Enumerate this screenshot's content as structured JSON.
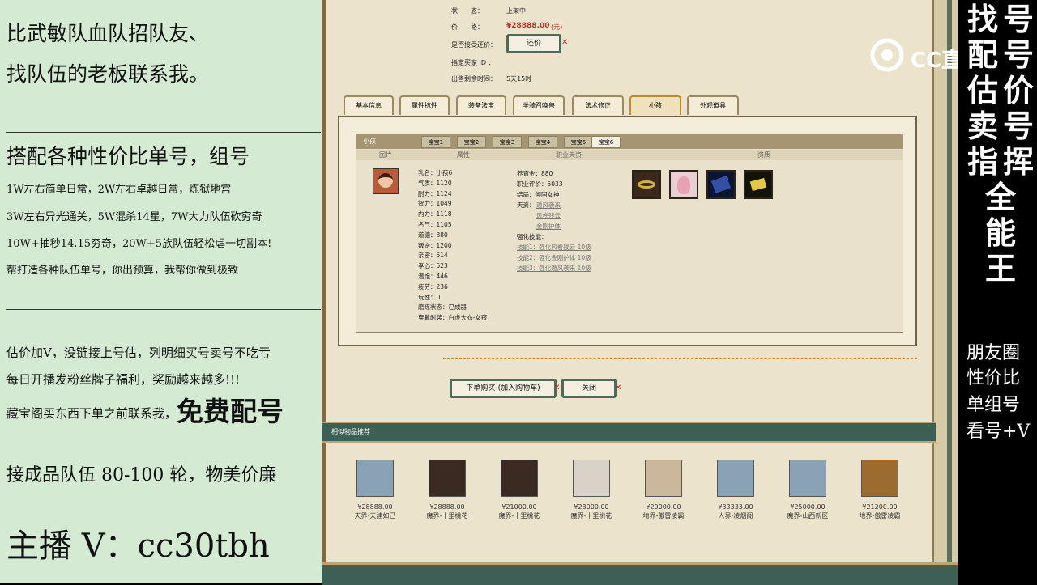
{
  "left_panel": {
    "line1": "比武敏队血队招队友、",
    "line2": "找队伍的老板联系我。",
    "heading2": "搭配各种性价比单号，组号",
    "p1": "1W左右简单日常，2W左右卓越日常，炼狱地宫",
    "p2": "3W左右异光通关，5W混杀14星，7W大力队伍砍穷奇",
    "p3": "10W+抽秒14.15穷奇，20W+5族队伍轻松虐一切副本!",
    "p4": "帮打造各种队伍单号，你出预算，我帮你做到极致",
    "p5": "估价加V，没链接上号估，列明细买号卖号不吃亏",
    "p6": "每日开播发粉丝牌子福利，奖励越来越多!!!",
    "p7_prefix": "藏宝阁买东西下单之前联系我，",
    "p7_big": "免费配号",
    "p8": "接成品队伍 80-100 轮，物美价廉",
    "anchor": "主播 V：cc30tbh"
  },
  "listing": {
    "status_label": "状　　态：",
    "status_value": "上架中",
    "price_label": "价　　格：",
    "price_value": "¥28888.00",
    "price_unit": "(元)",
    "bargain_label": "是否接受还价：",
    "bargain_button": "还价",
    "buyer_label": "指定买家 ID ：",
    "time_label": "出售剩余时间：",
    "time_value": "5天15时"
  },
  "tabs": [
    "基本信息",
    "属性抗性",
    "装备法宝",
    "坐骑召唤兽",
    "法术修正",
    "小孩",
    "外观道具"
  ],
  "child_panel": {
    "title": "小孩",
    "subtabs": [
      "宝宝1",
      "宝宝2",
      "宝宝3",
      "宝宝4",
      "宝宝5",
      "宝宝6"
    ],
    "col_headers": [
      "图片",
      "属性",
      "职业天资",
      "资质"
    ],
    "stats": [
      {
        "k": "乳名：",
        "v": "小孩6"
      },
      {
        "k": "气质：",
        "v": "1120"
      },
      {
        "k": "耐力：",
        "v": "1124"
      },
      {
        "k": "智力：",
        "v": "1049"
      },
      {
        "k": "内力：",
        "v": "1118"
      },
      {
        "k": "名气：",
        "v": "1105"
      },
      {
        "k": "道德：",
        "v": "380"
      },
      {
        "k": "叛逆：",
        "v": "1200"
      },
      {
        "k": "亲密：",
        "v": "514"
      },
      {
        "k": "孝心：",
        "v": "523"
      },
      {
        "k": "温饱：",
        "v": "446"
      },
      {
        "k": "疲劳：",
        "v": "236"
      },
      {
        "k": "玩性：",
        "v": "0"
      },
      {
        "k": "磨炼状态：",
        "v": "已成器"
      },
      {
        "k": "穿戴时装：",
        "v": "白虎大衣-女孩"
      }
    ],
    "growth_label": "养育金：",
    "growth_value": "880",
    "eval_label": "职业评价：",
    "eval_value": "5033",
    "ending_label": "结局：",
    "ending_value": "倾国女神",
    "talent_label": "天资：",
    "talents": [
      "遁风袭来",
      "风卷残云",
      "金刚护体"
    ],
    "skill_label": "强化技能：",
    "skills": [
      "技能1：强化风卷残云 10级",
      "技能2：强化金刚护体 10级",
      "技能3：强化遁风袭来 10级"
    ]
  },
  "actions": {
    "buy": "下单购买-(加入购物车)",
    "close": "关闭"
  },
  "similar": {
    "title": "相似物品推荐",
    "items": [
      {
        "price": "¥28888.00",
        "server": "天界-天建如己",
        "color": "#8aa2b5"
      },
      {
        "price": "¥28888.00",
        "server": "魔界-十里桃花",
        "color": "#3a2a22"
      },
      {
        "price": "¥21000.00",
        "server": "魔界-十里桃花",
        "color": "#3a2a22"
      },
      {
        "price": "¥28000.00",
        "server": "魔界-十里桃花",
        "color": "#d8d2c8"
      },
      {
        "price": "¥20000.00",
        "server": "地界-傲雷凌霸",
        "color": "#cbb89c"
      },
      {
        "price": "¥33333.00",
        "server": "人界-凌烟阁",
        "color": "#8aa2b5"
      },
      {
        "price": "¥25000.00",
        "server": "魔界-山西新区",
        "color": "#8aa2b5"
      },
      {
        "price": "¥21200.00",
        "server": "地界-傲雷凌霸",
        "color": "#9b6b30"
      }
    ]
  },
  "watermark": "CC直播",
  "right_panel": {
    "vertical_cols": [
      [
        "找",
        "配",
        "估",
        "卖",
        "指",
        "全",
        "能",
        "王"
      ],
      [
        "号",
        "号",
        "价",
        "号",
        "挥"
      ]
    ],
    "lines": [
      "朋友圈",
      "性价比",
      "单组号",
      "看号+V"
    ]
  }
}
